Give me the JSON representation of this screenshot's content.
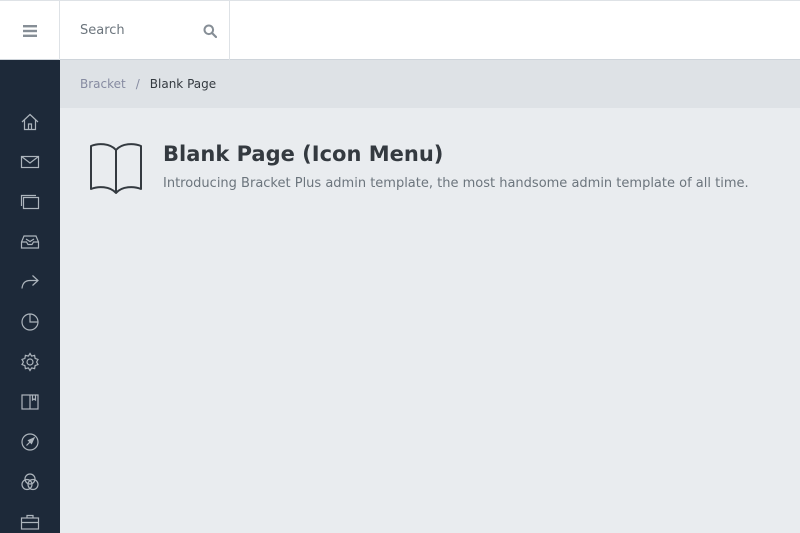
{
  "header": {
    "search_placeholder": "Search",
    "menu_icon": "hamburger-icon",
    "search_icon": "search-icon"
  },
  "sidebar": {
    "items": [
      {
        "icon": "home-icon"
      },
      {
        "icon": "mail-icon"
      },
      {
        "icon": "windows-icon"
      },
      {
        "icon": "inbox-icon"
      },
      {
        "icon": "share-icon"
      },
      {
        "icon": "pie-chart-icon"
      },
      {
        "icon": "gear-icon"
      },
      {
        "icon": "book-icon"
      },
      {
        "icon": "navigate-icon"
      },
      {
        "icon": "circles-icon"
      },
      {
        "icon": "briefcase-icon"
      }
    ]
  },
  "breadcrumb": {
    "root": "Bracket",
    "separator": "/",
    "current": "Blank Page"
  },
  "page": {
    "title": "Blank Page (Icon Menu)",
    "subtitle": "Introducing Bracket Plus admin template, the most handsome admin template of all time.",
    "icon": "open-book-icon"
  },
  "colors": {
    "sidebar_bg": "#1d2939",
    "content_bg": "#e9ecef",
    "breadcrumb_bg": "#dee2e6",
    "icon_color": "#adb5bd"
  }
}
